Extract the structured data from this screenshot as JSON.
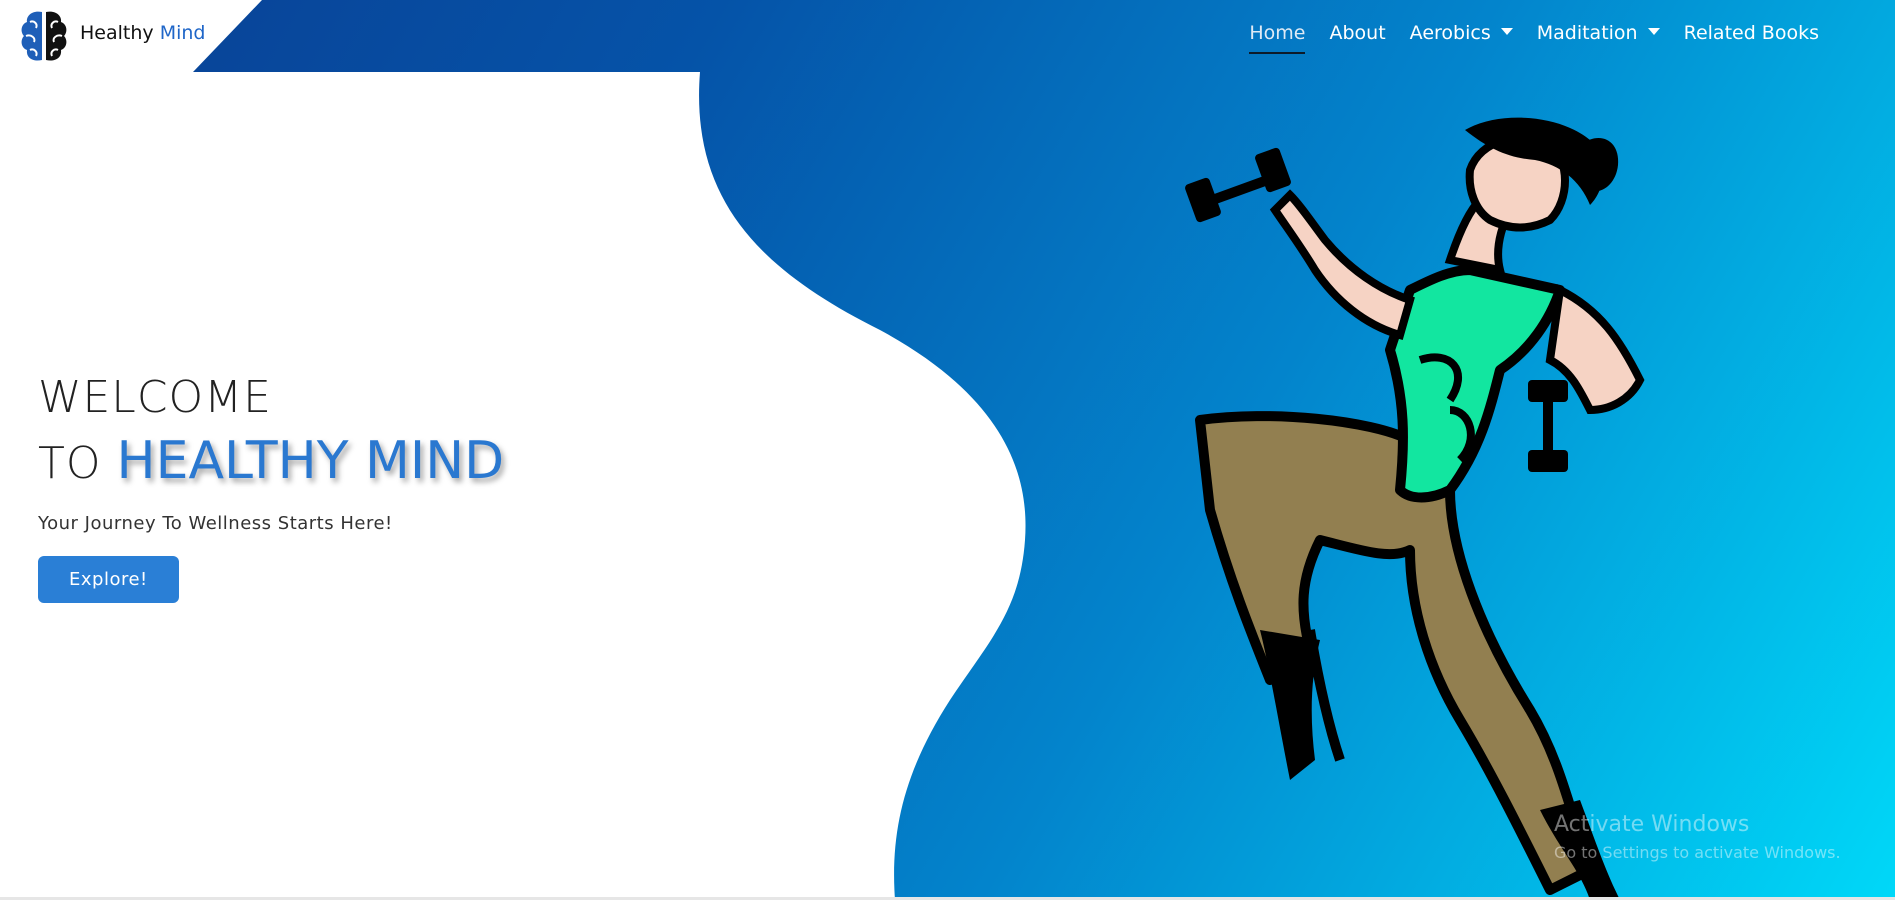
{
  "brand": {
    "name_part1": "Healthy",
    "name_part2": "Mind"
  },
  "nav": {
    "items": [
      {
        "label": "Home",
        "active": true,
        "dropdown": false
      },
      {
        "label": "About",
        "active": false,
        "dropdown": false
      },
      {
        "label": "Aerobics",
        "active": false,
        "dropdown": true
      },
      {
        "label": "Maditation",
        "active": false,
        "dropdown": true
      },
      {
        "label": "Related Books",
        "active": false,
        "dropdown": false
      }
    ]
  },
  "hero": {
    "welcome": "WELCOME",
    "to": "TO",
    "brand_word": "HEALTHY MIND",
    "tagline": "Your Journey To Wellness Starts Here!",
    "button_label": "Explore!"
  },
  "watermark": {
    "title": "Activate Windows",
    "subtitle": "Go to Settings to activate Windows."
  },
  "colors": {
    "accent": "#2a7fd6",
    "gradient_start": "#0a3f93",
    "gradient_end": "#00d8f8"
  },
  "icons": {
    "logo": "brain-icon",
    "dropdown": "caret-down-icon"
  }
}
